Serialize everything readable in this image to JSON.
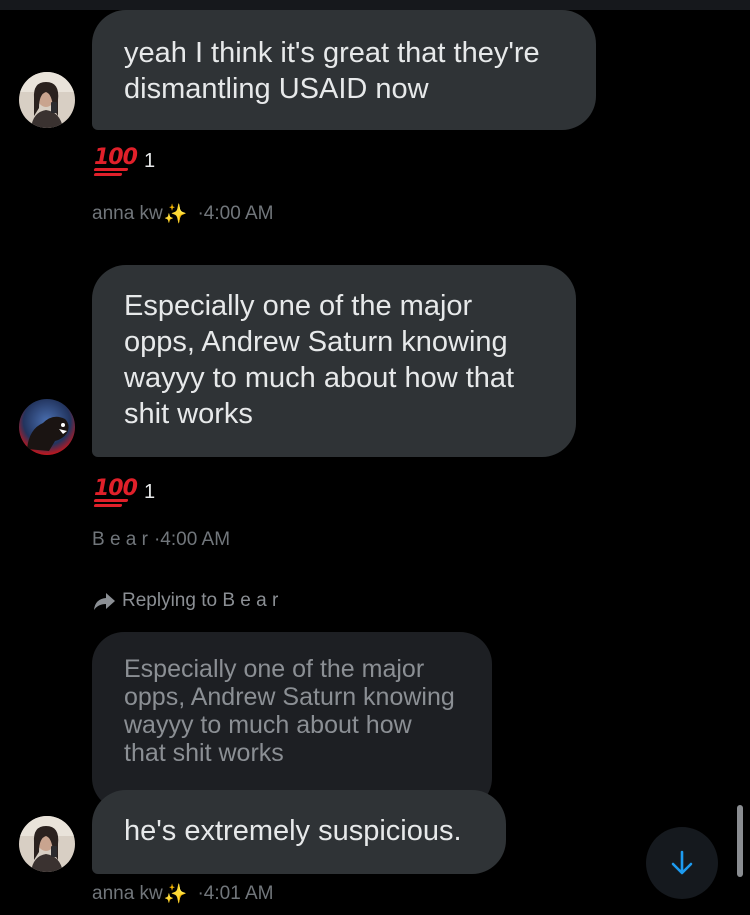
{
  "messages": [
    {
      "text": "yeah I think it's great that they're dismantling USAID now",
      "reaction_emoji": "100-emoji",
      "reaction_count": "1",
      "sender": "anna kw",
      "sender_sparkle": "✨",
      "time": "·4:00 AM"
    },
    {
      "text": "Especially one of the major opps, Andrew Saturn knowing wayyy to much about how that shit works",
      "reaction_emoji": "100-emoji",
      "reaction_count": "1",
      "sender": "B e a r",
      "time": "·4:00 AM"
    },
    {
      "reply_label": "Replying to B e a r",
      "quoted_text": "Especially one of the major opps, Andrew Saturn knowing wayyy to much about how that shit works",
      "text": "he's extremely suspicious.",
      "sender": "anna kw",
      "sender_sparkle": "✨",
      "time": "·4:01 AM"
    }
  ],
  "colors": {
    "background": "#000000",
    "bubble": "#2f3336",
    "quoted_bubble": "#1d1f23",
    "meta_text": "#71767b",
    "accent": "#1d9bf0",
    "reaction_red": "#e0202a"
  },
  "icons": {
    "reply": "reply-arrow-icon",
    "scroll_down": "arrow-down-icon"
  }
}
